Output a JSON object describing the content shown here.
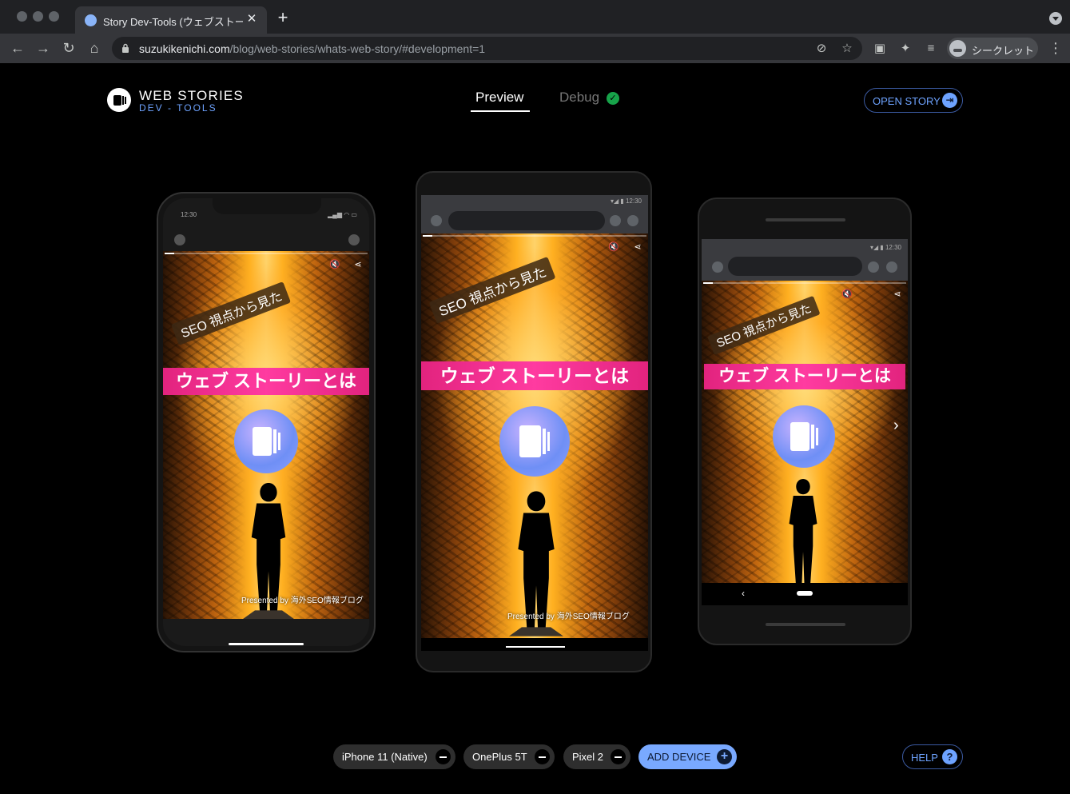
{
  "browser": {
    "tab_title": "Story Dev-Tools (ウェブストーリ",
    "url_domain": "suzukikenichi.com",
    "url_path": "/blog/web-stories/whats-web-story/#development=1",
    "incognito_label": "シークレット"
  },
  "header": {
    "brand_main": "WEB STORIES",
    "brand_sub": "DEV - TOOLS",
    "tabs": [
      {
        "label": "Preview",
        "active": true
      },
      {
        "label": "Debug",
        "active": false,
        "status": "ok"
      }
    ],
    "open_story_label": "OPEN STORY"
  },
  "story": {
    "subtitle": "SEO 視点から見た",
    "title": "ウェブ ストーリーとは",
    "presented_by": "Presented by 海外SEO情報ブログ"
  },
  "devices": [
    {
      "name": "iPhone 11 (Native)",
      "status_time": "12:30"
    },
    {
      "name": "OnePlus 5T",
      "status_time": "12:30"
    },
    {
      "name": "Pixel 2",
      "status_time": "12:30"
    }
  ],
  "footer": {
    "add_device_label": "ADD DEVICE",
    "help_label": "HELP"
  },
  "colors": {
    "accent": "#6ea3ff",
    "title_banner": "#e2237e",
    "debug_ok": "#17a34a"
  },
  "icons": [
    "back-arrow-icon",
    "forward-arrow-icon",
    "reload-icon",
    "home-icon",
    "lock-icon",
    "eye-off-icon",
    "star-icon",
    "extensions-icon",
    "mute-icon",
    "share-icon",
    "next-arrow-icon",
    "help-icon"
  ]
}
